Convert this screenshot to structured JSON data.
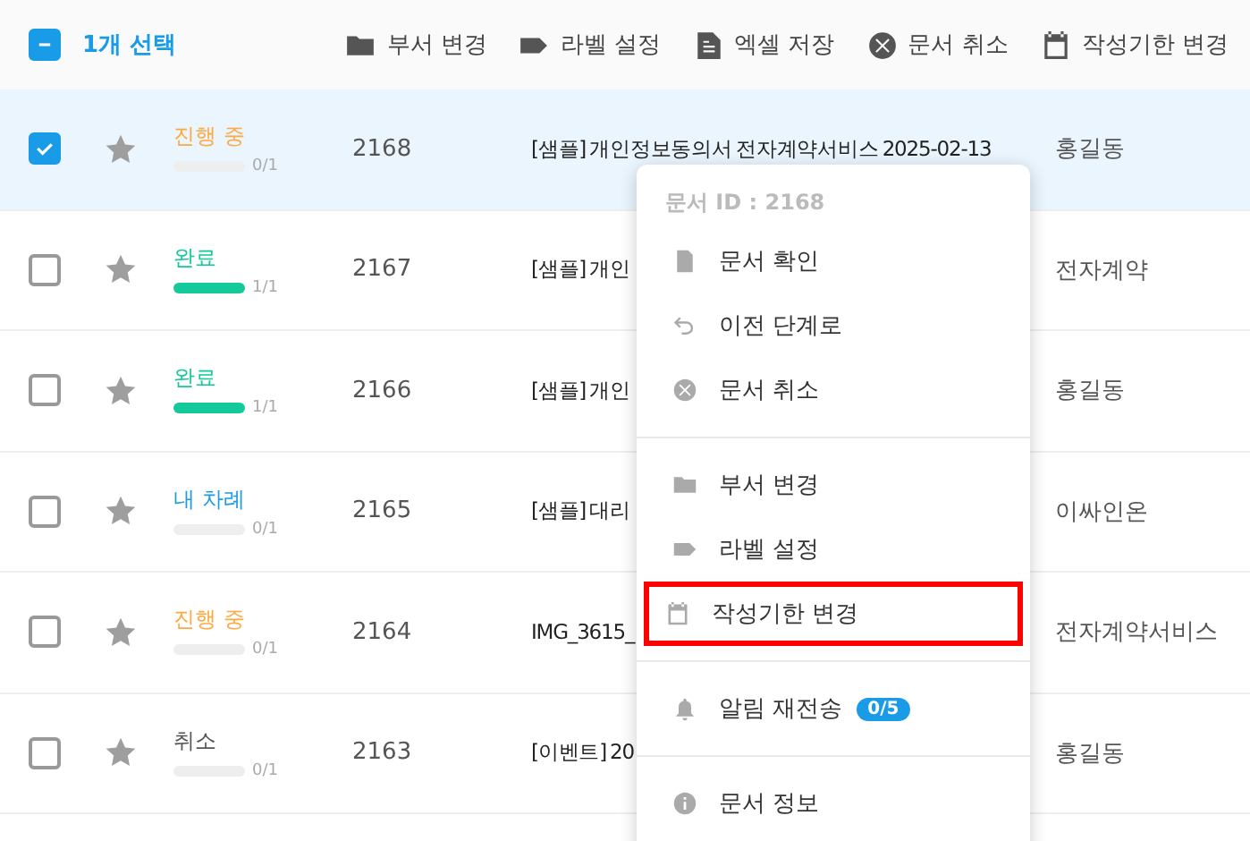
{
  "toolbar": {
    "select_all": {
      "partial": true
    },
    "selection_count": "1개 선택",
    "actions": [
      {
        "label": "부서 변경"
      },
      {
        "label": "라벨 설정"
      },
      {
        "label": "엑셀 저장"
      },
      {
        "label": "문서 취소"
      },
      {
        "label": "작성기한 변경"
      }
    ]
  },
  "rows": [
    {
      "selected": true,
      "starred": false,
      "status": "진행 중",
      "color": "#ffa940",
      "level": 0,
      "progress": "0/1",
      "id": "2168",
      "title": "[샘플] 개인정보동의서  전자계약서비스  2025-02-13",
      "owner": "홍길동"
    },
    {
      "selected": false,
      "starred": false,
      "status": "완료",
      "color": "#14c99a",
      "level": 1,
      "progress": "1/1",
      "id": "2167",
      "title": "[샘플] 개인",
      "owner": "전자계약"
    },
    {
      "selected": false,
      "starred": false,
      "status": "완료",
      "color": "#14c99a",
      "level": 1,
      "progress": "1/1",
      "id": "2166",
      "title": "[샘플] 개인",
      "owner": "홍길동"
    },
    {
      "selected": false,
      "starred": false,
      "status": "내 차례",
      "color": "#1a9be8",
      "level": 0,
      "progress": "0/1",
      "id": "2165",
      "title": "[샘플] 대리",
      "owner": "이싸인온"
    },
    {
      "selected": false,
      "starred": false,
      "status": "진행 중",
      "color": "#ffa940",
      "level": 0,
      "progress": "0/1",
      "id": "2164",
      "title": "IMG_3615_",
      "owner": "전자계약서비스"
    },
    {
      "selected": false,
      "starred": false,
      "status": "취소",
      "color": "#555555",
      "level": 0,
      "progress": "0/1",
      "id": "2163",
      "title": "[이벤트] 20",
      "owner": "홍길동"
    }
  ],
  "context_menu": {
    "header": "문서 ID : 2168",
    "groups": [
      [
        {
          "label": "문서 확인",
          "highlighted": false
        },
        {
          "label": "이전 단계로",
          "highlighted": false
        },
        {
          "label": "문서 취소",
          "highlighted": false
        }
      ],
      [
        {
          "label": "부서 변경",
          "highlighted": false
        },
        {
          "label": "라벨 설정",
          "highlighted": false
        },
        {
          "label": "작성기한 변경",
          "highlighted": true
        }
      ],
      [
        {
          "label": "알림 재전송",
          "badge": "0/5",
          "highlighted": false
        }
      ],
      [
        {
          "label": "문서 정보",
          "highlighted": false
        }
      ]
    ]
  }
}
